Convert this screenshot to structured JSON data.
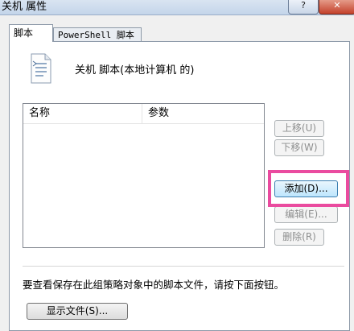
{
  "window": {
    "title": "关机 属性",
    "help_label": "?",
    "close_label": "✕"
  },
  "tabs": [
    {
      "label": "脚本",
      "active": true
    },
    {
      "label": "PowerShell 脚本",
      "active": false
    }
  ],
  "panel": {
    "icon": "script-document-icon",
    "heading": "关机 脚本(本地计算机 的)",
    "list": {
      "columns": [
        "名称",
        "参数"
      ],
      "rows": []
    },
    "buttons": {
      "move_up": "上移(U)",
      "move_down": "下移(W)",
      "add": "添加(D)...",
      "edit": "编辑(E)...",
      "remove": "删除(R)",
      "show_files": "显示文件(S)..."
    },
    "instruction": "要查看保存在此组策略对象中的脚本文件，请按下面按钮。"
  },
  "colors": {
    "highlight": "#ea4b9f",
    "disabled_text": "#8e8f8f"
  }
}
